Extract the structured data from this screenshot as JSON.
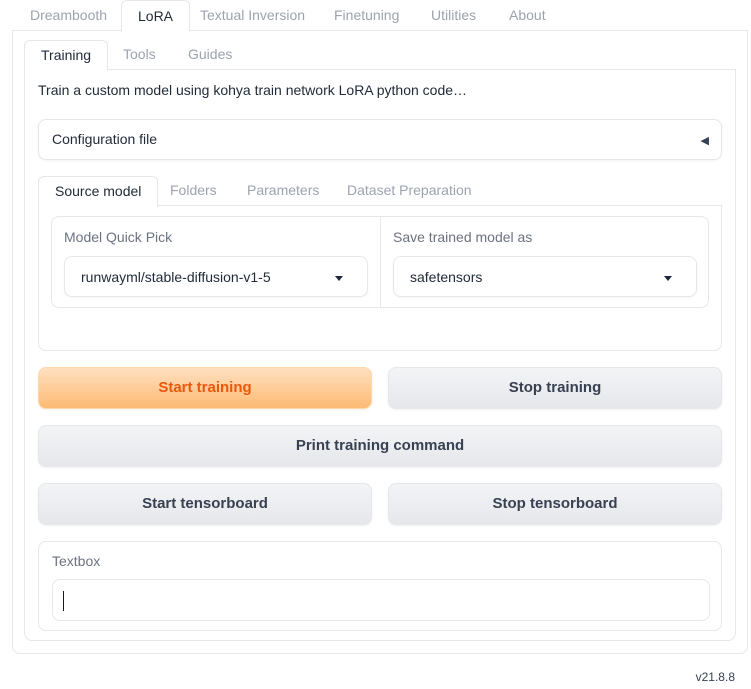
{
  "top_tabs": [
    {
      "label": "Dreambooth"
    },
    {
      "label": "LoRA"
    },
    {
      "label": "Textual Inversion"
    },
    {
      "label": "Finetuning"
    },
    {
      "label": "Utilities"
    },
    {
      "label": "About"
    }
  ],
  "sub_tabs": [
    {
      "label": "Training"
    },
    {
      "label": "Tools"
    },
    {
      "label": "Guides"
    }
  ],
  "description": "Train a custom model using kohya train network LoRA python code…",
  "config_accordion": {
    "label": "Configuration file",
    "indicator": "◀"
  },
  "source_tabs": [
    {
      "label": "Source model"
    },
    {
      "label": "Folders"
    },
    {
      "label": "Parameters"
    },
    {
      "label": "Dataset Preparation"
    }
  ],
  "model_quick_pick": {
    "label": "Model Quick Pick",
    "value": "runwayml/stable-diffusion-v1-5"
  },
  "save_as": {
    "label": "Save trained model as",
    "value": "safetensors"
  },
  "buttons": {
    "start_training": "Start training",
    "stop_training": "Stop training",
    "print_command": "Print training command",
    "start_tensorboard": "Start tensorboard",
    "stop_tensorboard": "Stop tensorboard"
  },
  "textbox": {
    "label": "Textbox",
    "value": ""
  },
  "version": "v21.8.8",
  "colors": {
    "primary_text": "#ea580c",
    "primary_bg": "#fdba74",
    "border": "#e5e7eb"
  }
}
